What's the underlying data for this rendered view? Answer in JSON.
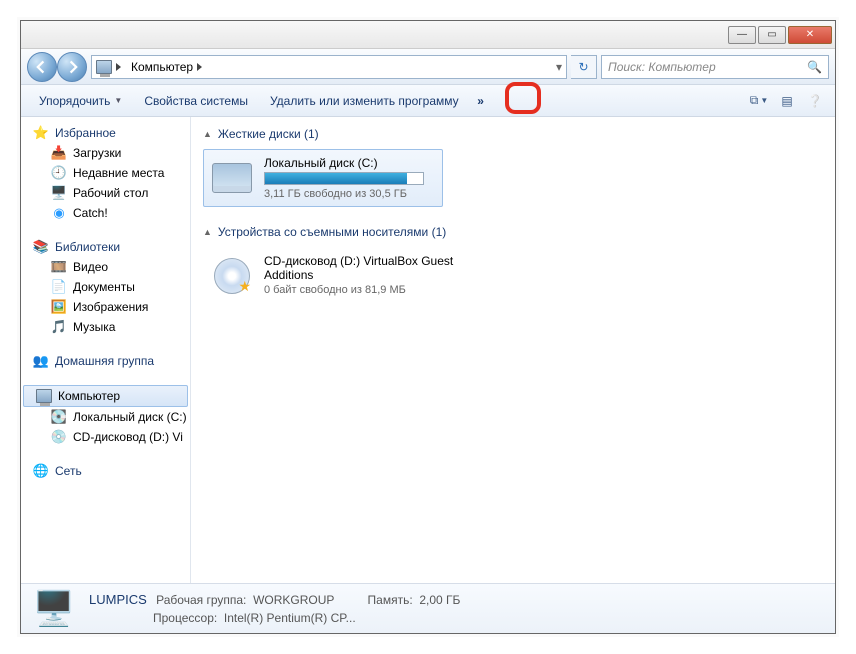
{
  "address": {
    "root_label": "Компьютер"
  },
  "search": {
    "placeholder": "Поиск: Компьютер"
  },
  "toolbar": {
    "organize": "Упорядочить",
    "props": "Свойства системы",
    "uninstall": "Удалить или изменить программу",
    "overflow_glyph": "»"
  },
  "sidebar": {
    "favorites": {
      "label": "Избранное",
      "items": [
        "Загрузки",
        "Недавние места",
        "Рабочий стол",
        "Catch!"
      ]
    },
    "libraries": {
      "label": "Библиотеки",
      "items": [
        "Видео",
        "Документы",
        "Изображения",
        "Музыка"
      ]
    },
    "homegroup": "Домашняя группа",
    "computer": {
      "label": "Компьютер",
      "items": [
        "Локальный диск (C:)",
        "CD-дисковод (D:) Vi"
      ]
    },
    "network": "Сеть"
  },
  "groups": {
    "hdd": {
      "title": "Жесткие диски (1)"
    },
    "removable": {
      "title": "Устройства со съемными носителями (1)"
    }
  },
  "drives": {
    "c": {
      "name": "Локальный диск (C:)",
      "free_text": "3,11 ГБ свободно из 30,5 ГБ",
      "fill_pct": 90
    },
    "d": {
      "name": "CD-дисковод (D:) VirtualBox Guest Additions",
      "free_text": "0 байт свободно из 81,9 МБ"
    }
  },
  "status": {
    "pcname": "LUMPICS",
    "workgroup_label": "Рабочая группа:",
    "workgroup": "WORKGROUP",
    "mem_label": "Память:",
    "mem": "2,00 ГБ",
    "cpu_label": "Процессор:",
    "cpu": "Intel(R) Pentium(R) CP..."
  }
}
